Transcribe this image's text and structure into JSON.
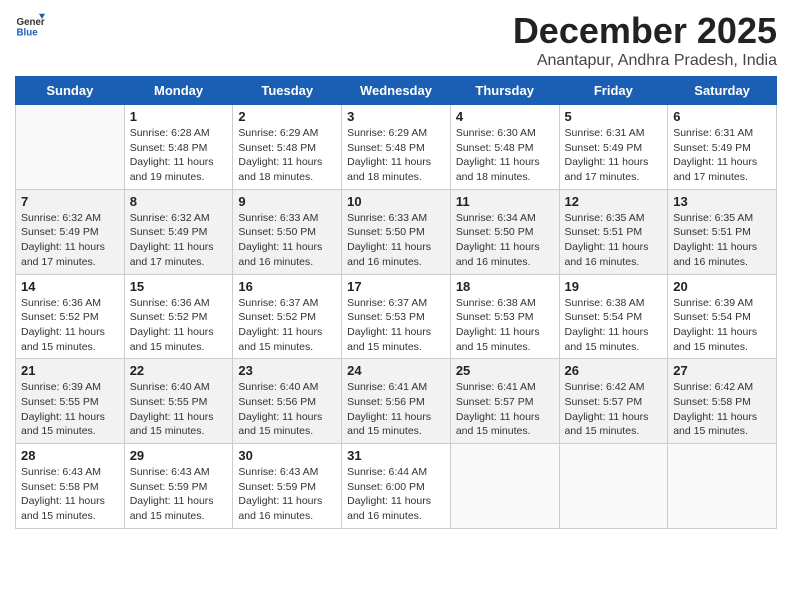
{
  "logo": {
    "general": "General",
    "blue": "Blue"
  },
  "header": {
    "month": "December 2025",
    "location": "Anantapur, Andhra Pradesh, India"
  },
  "days_of_week": [
    "Sunday",
    "Monday",
    "Tuesday",
    "Wednesday",
    "Thursday",
    "Friday",
    "Saturday"
  ],
  "weeks": [
    [
      {
        "day": "",
        "info": ""
      },
      {
        "day": "1",
        "info": "Sunrise: 6:28 AM\nSunset: 5:48 PM\nDaylight: 11 hours\nand 19 minutes."
      },
      {
        "day": "2",
        "info": "Sunrise: 6:29 AM\nSunset: 5:48 PM\nDaylight: 11 hours\nand 18 minutes."
      },
      {
        "day": "3",
        "info": "Sunrise: 6:29 AM\nSunset: 5:48 PM\nDaylight: 11 hours\nand 18 minutes."
      },
      {
        "day": "4",
        "info": "Sunrise: 6:30 AM\nSunset: 5:48 PM\nDaylight: 11 hours\nand 18 minutes."
      },
      {
        "day": "5",
        "info": "Sunrise: 6:31 AM\nSunset: 5:49 PM\nDaylight: 11 hours\nand 17 minutes."
      },
      {
        "day": "6",
        "info": "Sunrise: 6:31 AM\nSunset: 5:49 PM\nDaylight: 11 hours\nand 17 minutes."
      }
    ],
    [
      {
        "day": "7",
        "info": "Sunrise: 6:32 AM\nSunset: 5:49 PM\nDaylight: 11 hours\nand 17 minutes."
      },
      {
        "day": "8",
        "info": "Sunrise: 6:32 AM\nSunset: 5:49 PM\nDaylight: 11 hours\nand 17 minutes."
      },
      {
        "day": "9",
        "info": "Sunrise: 6:33 AM\nSunset: 5:50 PM\nDaylight: 11 hours\nand 16 minutes."
      },
      {
        "day": "10",
        "info": "Sunrise: 6:33 AM\nSunset: 5:50 PM\nDaylight: 11 hours\nand 16 minutes."
      },
      {
        "day": "11",
        "info": "Sunrise: 6:34 AM\nSunset: 5:50 PM\nDaylight: 11 hours\nand 16 minutes."
      },
      {
        "day": "12",
        "info": "Sunrise: 6:35 AM\nSunset: 5:51 PM\nDaylight: 11 hours\nand 16 minutes."
      },
      {
        "day": "13",
        "info": "Sunrise: 6:35 AM\nSunset: 5:51 PM\nDaylight: 11 hours\nand 16 minutes."
      }
    ],
    [
      {
        "day": "14",
        "info": "Sunrise: 6:36 AM\nSunset: 5:52 PM\nDaylight: 11 hours\nand 15 minutes."
      },
      {
        "day": "15",
        "info": "Sunrise: 6:36 AM\nSunset: 5:52 PM\nDaylight: 11 hours\nand 15 minutes."
      },
      {
        "day": "16",
        "info": "Sunrise: 6:37 AM\nSunset: 5:52 PM\nDaylight: 11 hours\nand 15 minutes."
      },
      {
        "day": "17",
        "info": "Sunrise: 6:37 AM\nSunset: 5:53 PM\nDaylight: 11 hours\nand 15 minutes."
      },
      {
        "day": "18",
        "info": "Sunrise: 6:38 AM\nSunset: 5:53 PM\nDaylight: 11 hours\nand 15 minutes."
      },
      {
        "day": "19",
        "info": "Sunrise: 6:38 AM\nSunset: 5:54 PM\nDaylight: 11 hours\nand 15 minutes."
      },
      {
        "day": "20",
        "info": "Sunrise: 6:39 AM\nSunset: 5:54 PM\nDaylight: 11 hours\nand 15 minutes."
      }
    ],
    [
      {
        "day": "21",
        "info": "Sunrise: 6:39 AM\nSunset: 5:55 PM\nDaylight: 11 hours\nand 15 minutes."
      },
      {
        "day": "22",
        "info": "Sunrise: 6:40 AM\nSunset: 5:55 PM\nDaylight: 11 hours\nand 15 minutes."
      },
      {
        "day": "23",
        "info": "Sunrise: 6:40 AM\nSunset: 5:56 PM\nDaylight: 11 hours\nand 15 minutes."
      },
      {
        "day": "24",
        "info": "Sunrise: 6:41 AM\nSunset: 5:56 PM\nDaylight: 11 hours\nand 15 minutes."
      },
      {
        "day": "25",
        "info": "Sunrise: 6:41 AM\nSunset: 5:57 PM\nDaylight: 11 hours\nand 15 minutes."
      },
      {
        "day": "26",
        "info": "Sunrise: 6:42 AM\nSunset: 5:57 PM\nDaylight: 11 hours\nand 15 minutes."
      },
      {
        "day": "27",
        "info": "Sunrise: 6:42 AM\nSunset: 5:58 PM\nDaylight: 11 hours\nand 15 minutes."
      }
    ],
    [
      {
        "day": "28",
        "info": "Sunrise: 6:43 AM\nSunset: 5:58 PM\nDaylight: 11 hours\nand 15 minutes."
      },
      {
        "day": "29",
        "info": "Sunrise: 6:43 AM\nSunset: 5:59 PM\nDaylight: 11 hours\nand 15 minutes."
      },
      {
        "day": "30",
        "info": "Sunrise: 6:43 AM\nSunset: 5:59 PM\nDaylight: 11 hours\nand 16 minutes."
      },
      {
        "day": "31",
        "info": "Sunrise: 6:44 AM\nSunset: 6:00 PM\nDaylight: 11 hours\nand 16 minutes."
      },
      {
        "day": "",
        "info": ""
      },
      {
        "day": "",
        "info": ""
      },
      {
        "day": "",
        "info": ""
      }
    ]
  ]
}
